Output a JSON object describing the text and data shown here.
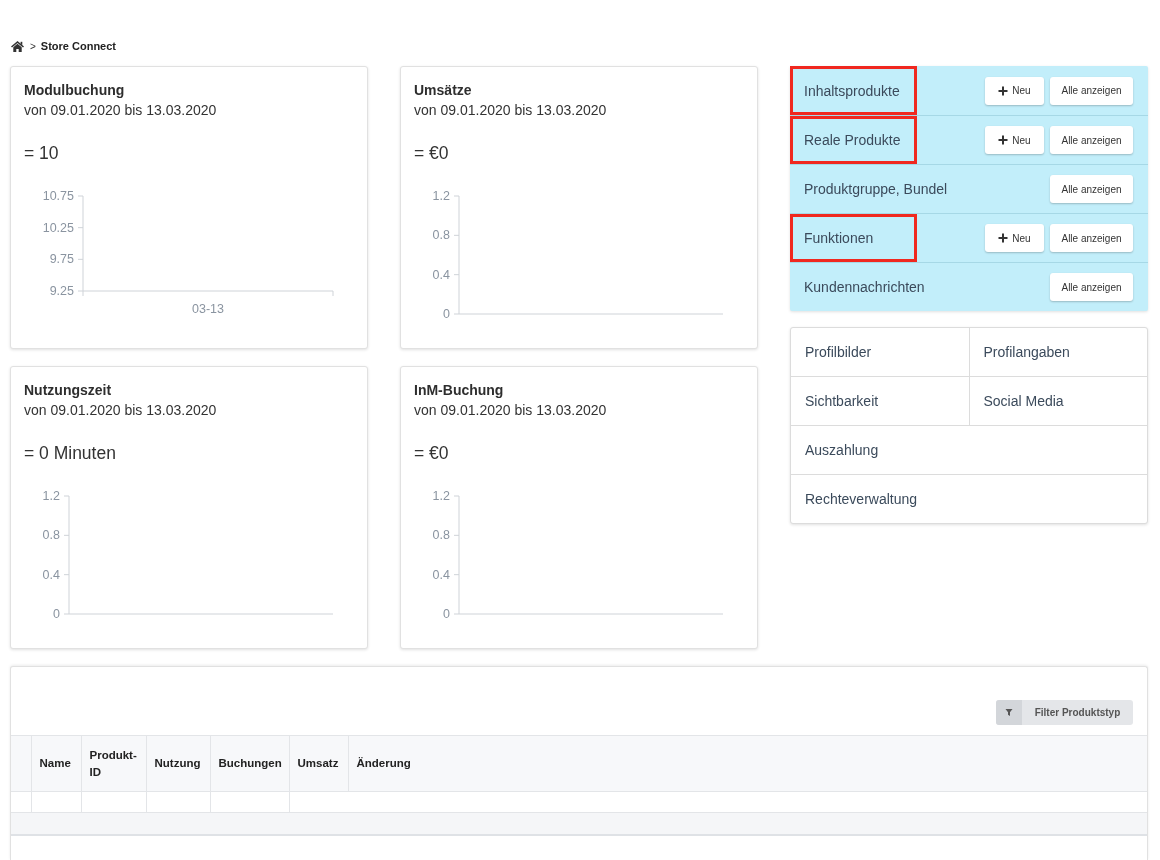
{
  "breadcrumb": {
    "separator": ">",
    "current": "Store Connect"
  },
  "stat_cards": [
    {
      "title": "Modulbuchung",
      "period": "von 09.01.2020 bis 13.03.2020",
      "total": "= 10",
      "chart_data": {
        "type": "line",
        "categories": [
          "03-13"
        ],
        "ylim": [
          9.25,
          10.75
        ],
        "yticks": [
          9.25,
          9.75,
          10.25,
          10.75
        ]
      }
    },
    {
      "title": "Umsätze",
      "period": "von 09.01.2020 bis 13.03.2020",
      "total": "= €0",
      "chart_data": {
        "type": "line",
        "categories": [
          null
        ],
        "ylim": [
          0,
          1.2
        ],
        "yticks": [
          0,
          0.4,
          0.8,
          1.2
        ]
      }
    },
    {
      "title": "Nutzungszeit",
      "period": "von 09.01.2020 bis 13.03.2020",
      "total": "= 0 Minuten",
      "chart_data": {
        "type": "line",
        "categories": [
          null
        ],
        "ylim": [
          0,
          1.2
        ],
        "yticks": [
          0,
          0.4,
          0.8,
          1.2
        ]
      }
    },
    {
      "title": "InM-Buchung",
      "period": "von 09.01.2020 bis 13.03.2020",
      "total": "= €0",
      "chart_data": {
        "type": "line",
        "categories": [
          null
        ],
        "ylim": [
          0,
          1.2
        ],
        "yticks": [
          0,
          0.4,
          0.8,
          1.2
        ]
      }
    }
  ],
  "product_panel": {
    "rows": [
      {
        "label": "Inhaltsprodukte",
        "highlighted": true,
        "buttons": [
          {
            "kind": "new",
            "label": "Neu"
          },
          {
            "kind": "all",
            "label": "Alle anzeigen"
          }
        ]
      },
      {
        "label": "Reale Produkte",
        "highlighted": true,
        "buttons": [
          {
            "kind": "new",
            "label": "Neu"
          },
          {
            "kind": "all",
            "label": "Alle anzeigen"
          }
        ]
      },
      {
        "label": "Produktgruppe, Bundel",
        "highlighted": false,
        "buttons": [
          {
            "kind": "all",
            "label": "Alle anzeigen"
          }
        ]
      },
      {
        "label": "Funktionen",
        "highlighted": true,
        "buttons": [
          {
            "kind": "new",
            "label": "Neu"
          },
          {
            "kind": "all",
            "label": "Alle anzeigen"
          }
        ]
      },
      {
        "label": "Kundennachrichten",
        "highlighted": false,
        "buttons": [
          {
            "kind": "all",
            "label": "Alle anzeigen"
          }
        ]
      }
    ]
  },
  "profile_menu": {
    "rows": [
      [
        "Profilbilder",
        "Profilangaben"
      ],
      [
        "Sichtbarkeit",
        "Social Media"
      ],
      [
        "Auszahlung"
      ],
      [
        "Rechteverwaltung"
      ]
    ]
  },
  "products_table": {
    "filter_button": "Filter Produktstyp",
    "columns": [
      "Name",
      "Produkt-ID",
      "Nutzung",
      "Buchungen",
      "Umsatz",
      "Änderung"
    ]
  }
}
